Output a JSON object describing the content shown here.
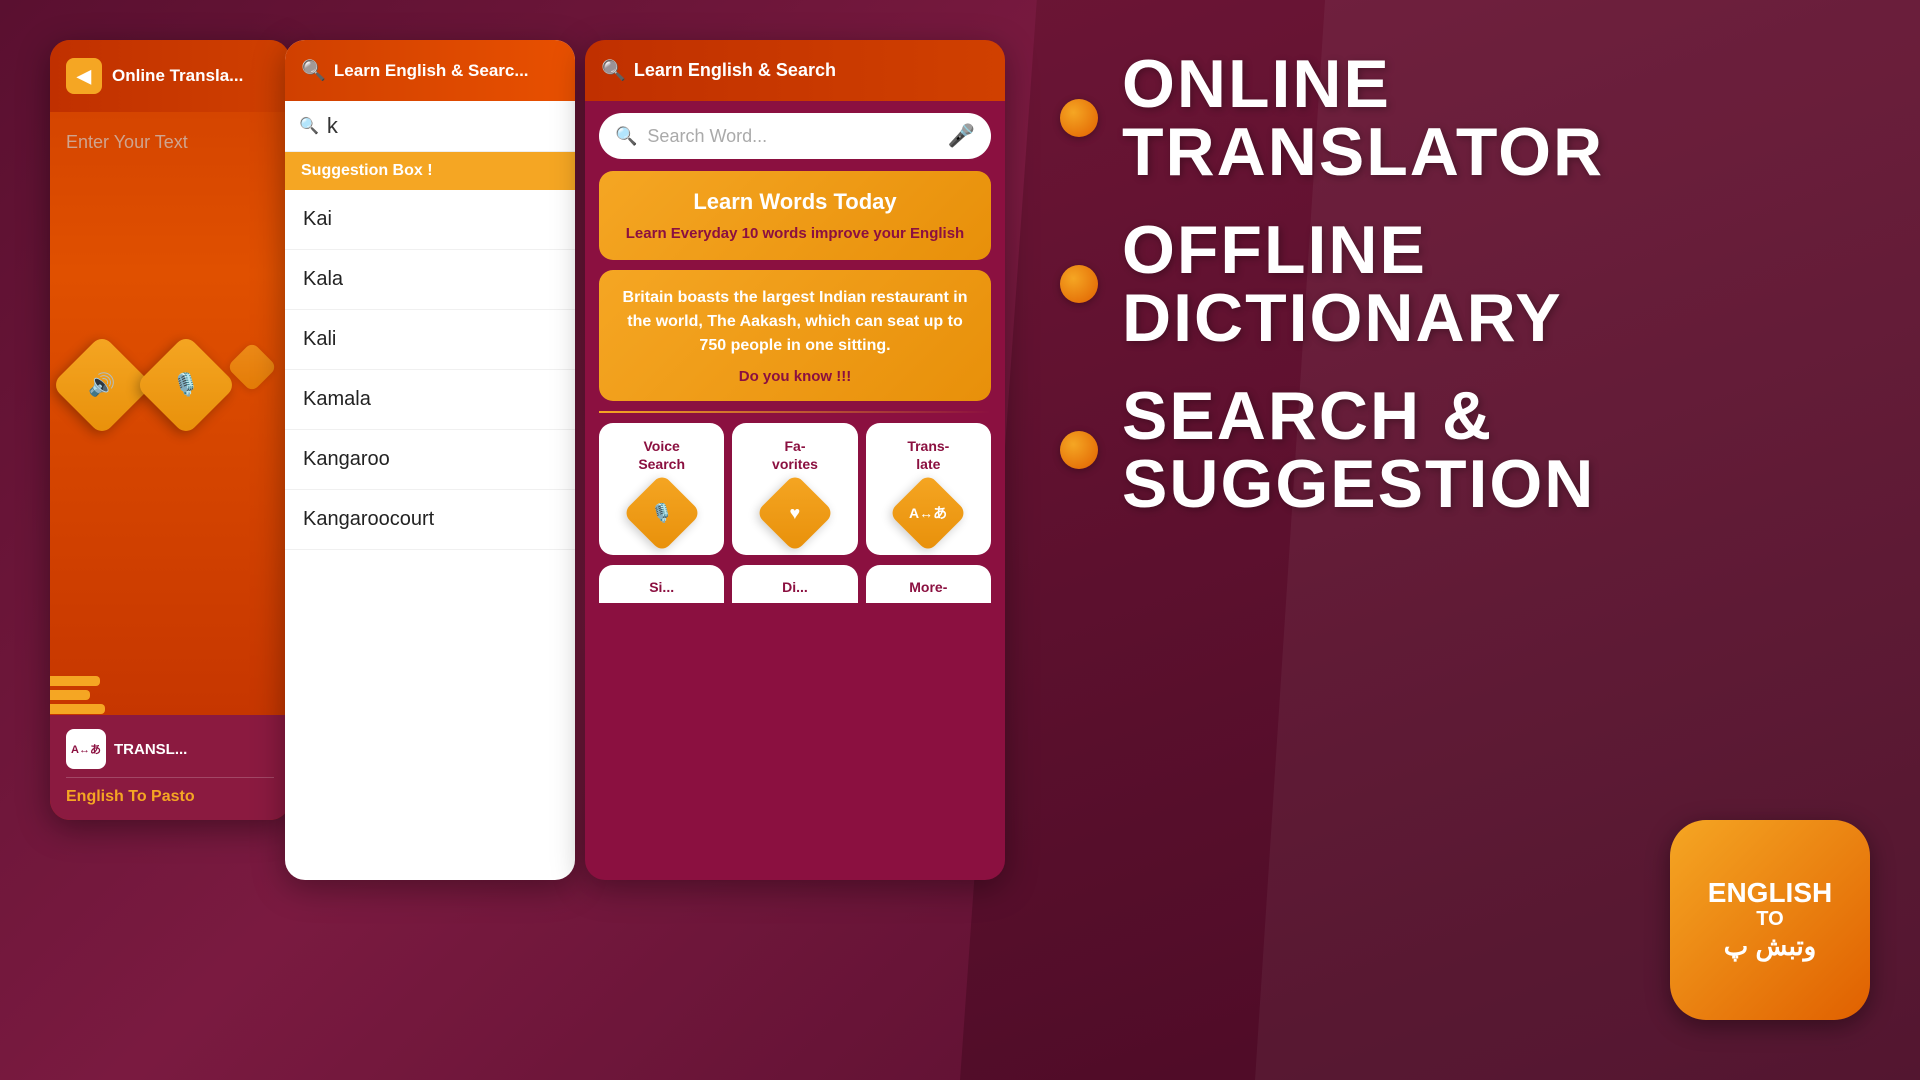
{
  "app": {
    "title": "Online Translator",
    "back_icon": "◀",
    "enter_text_placeholder": "Enter Your Text"
  },
  "left_panel": {
    "header_title": "Online Transla...",
    "placeholder": "Enter Your Text",
    "icons": [
      {
        "name": "speaker-icon",
        "symbol": "🔊"
      },
      {
        "name": "mic-icon",
        "symbol": "🎙️"
      }
    ],
    "translate_tab": "TRANSL...",
    "language": "English To Pasto"
  },
  "middle_panel": {
    "header_title": "Learn English & Searc...",
    "search_value": "k",
    "suggestion_header": "Suggestion Box !",
    "suggestions": [
      "Kai",
      "Kala",
      "Kali",
      "Kamala",
      "Kangaroo",
      "Kangaroocourt"
    ]
  },
  "right_panel": {
    "header_title": "Learn English & Search",
    "search_placeholder": "Search Word...",
    "learn_card": {
      "title": "Learn Words Today",
      "subtitle": "Learn Everyday 10 words improve your English"
    },
    "know_card": {
      "body": "Britain  boasts the  largest Indian restaurant  in the world, The Aakash, which can seat up to 750 people  in one sitting.",
      "label": "Do you know !!!"
    },
    "features": [
      {
        "label": "Voice Search",
        "icon": "🎙️"
      },
      {
        "label": "Fa-\nvorites",
        "icon": "♥"
      },
      {
        "label": "Trans-\nlate",
        "icon": "🔤"
      }
    ],
    "partial_features": [
      {
        "label": "Si..."
      },
      {
        "label": "Di..."
      },
      {
        "label": "More-"
      }
    ]
  },
  "far_right": {
    "items": [
      {
        "dot": true,
        "line1": "ONLINE",
        "line2": "TRANSLATOR"
      },
      {
        "dot": true,
        "line1": "OFFLINE",
        "line2": "DICTIONARY"
      },
      {
        "dot": true,
        "line1": "SEARCH &",
        "line2": "SUGGESTION"
      }
    ]
  },
  "app_icon": {
    "line1": "ENGLISH",
    "line2": "TO",
    "line3": "وتبش پ"
  }
}
